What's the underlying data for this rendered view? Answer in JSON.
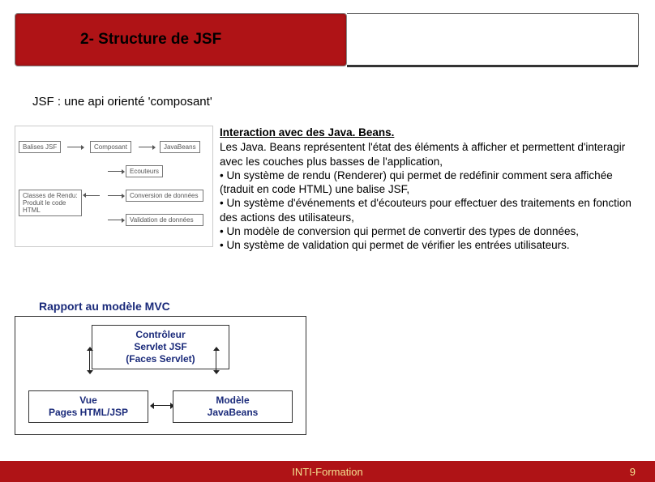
{
  "header": {
    "title": "2- Structure de JSF"
  },
  "subtitle": "JSF : une api orienté 'composant'",
  "diagram1": {
    "balises": "Balises JSF",
    "composant": "Composant",
    "javabeans": "JavaBeans",
    "ecouteurs": "Ecouteurs",
    "conversion": "Conversion de données",
    "rendu": "Classes de Rendu: Produit le code HTML",
    "validation": "Validation de données"
  },
  "content": {
    "heading": "Interaction avec des Java. Beans.",
    "p1": "Les Java. Beans représentent l'état des éléments à afficher et permettent d'interagir avec les couches plus basses de l'application,",
    "b1": "• Un système de rendu (Renderer) qui permet de redéfinir comment sera affichée (traduit en code HTML) une balise JSF,",
    "b2": "• Un système d'événements et d'écouteurs pour effectuer des traitements en fonction des actions des utilisateurs,",
    "b3": "• Un modèle de conversion qui permet de convertir des types de données,",
    "b4": "• Un système de validation qui permet de vérifier les entrées utilisateurs."
  },
  "mvc": {
    "title": "Rapport au modèle MVC",
    "controller_l1": "Contrôleur",
    "controller_l2": "Servlet JSF",
    "controller_l3": "(Faces Servlet)",
    "view_l1": "Vue",
    "view_l2": "Pages HTML/JSP",
    "model_l1": "Modèle",
    "model_l2": "JavaBeans"
  },
  "footer": {
    "text": "INTI-Formation",
    "page": "9"
  }
}
